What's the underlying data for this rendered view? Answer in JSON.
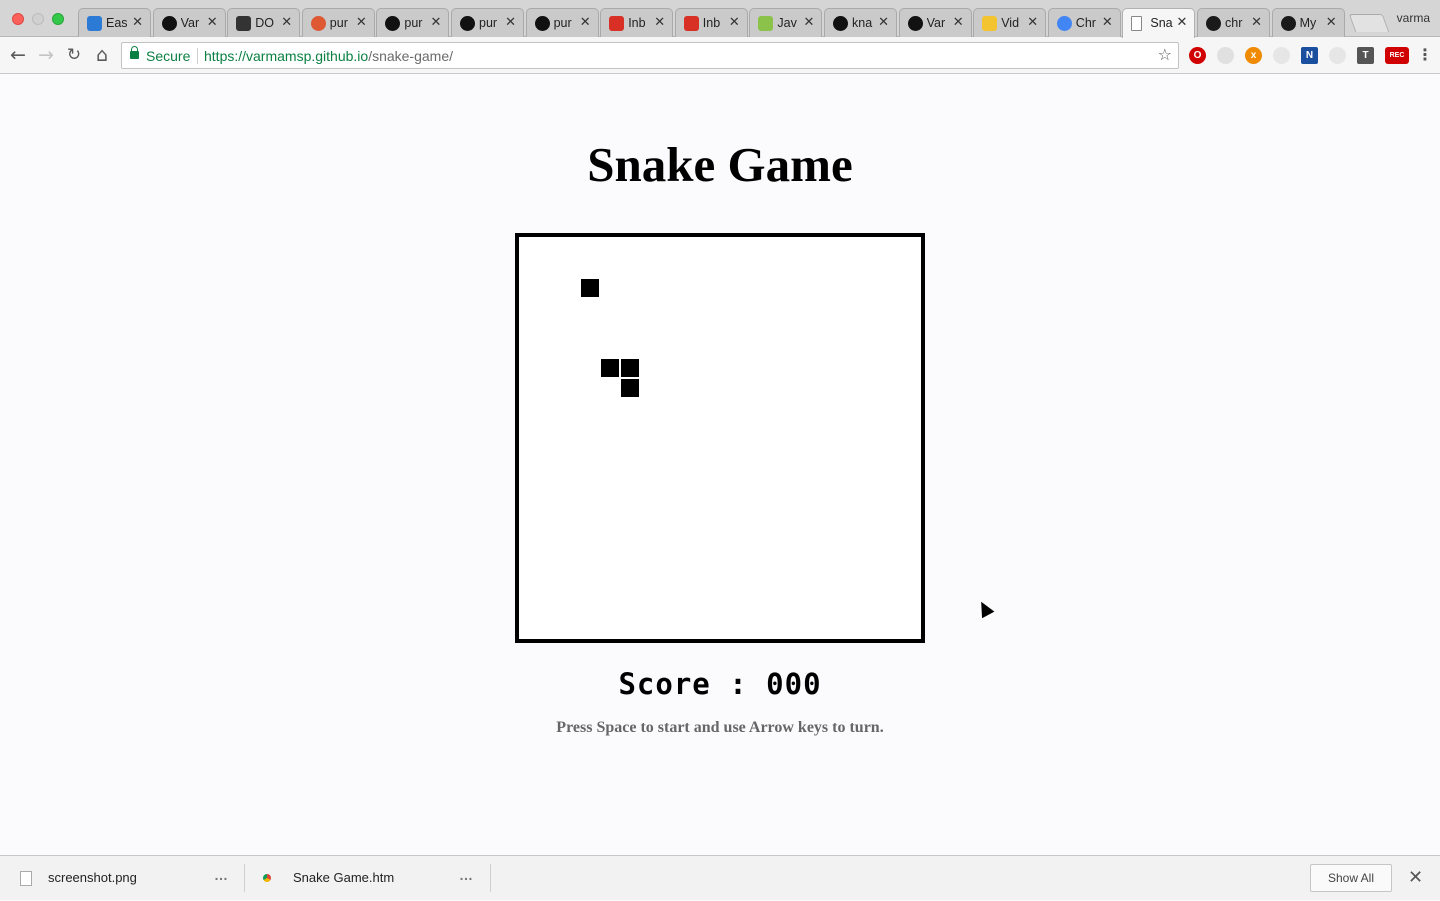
{
  "browser": {
    "profile_name": "varma",
    "tabs": [
      {
        "title": "Eas",
        "icon": "easy-icon",
        "icon_color": "#2b7bd6",
        "active": false
      },
      {
        "title": "Var",
        "icon": "github-icon",
        "icon_color": "#111111",
        "active": false
      },
      {
        "title": "DO",
        "icon": "dom-link-icon",
        "icon_color": "#333333",
        "active": false
      },
      {
        "title": "pur",
        "icon": "duckduckgo-icon",
        "icon_color": "#de5833",
        "active": false
      },
      {
        "title": "pur",
        "icon": "github-icon",
        "icon_color": "#111111",
        "active": false
      },
      {
        "title": "pur",
        "icon": "github-icon",
        "icon_color": "#111111",
        "active": false
      },
      {
        "title": "pur",
        "icon": "github-icon",
        "icon_color": "#111111",
        "active": false
      },
      {
        "title": "Inb",
        "icon": "gmail-icon",
        "icon_color": "#d93025",
        "active": false
      },
      {
        "title": "Inb",
        "icon": "gmail-icon",
        "icon_color": "#d93025",
        "active": false
      },
      {
        "title": "Jav",
        "icon": "javascript-icon",
        "icon_color": "#8bc34a",
        "active": false
      },
      {
        "title": "kna",
        "icon": "github-icon",
        "icon_color": "#111111",
        "active": false
      },
      {
        "title": "Var",
        "icon": "github-icon",
        "icon_color": "#111111",
        "active": false
      },
      {
        "title": "Vid",
        "icon": "video-icon",
        "icon_color": "#f4c430",
        "active": false
      },
      {
        "title": "Chr",
        "icon": "chrome-icon",
        "icon_color": "#4285f4",
        "active": false
      },
      {
        "title": "Sna",
        "icon": "page-icon",
        "icon_color": "#ffffff",
        "active": true
      },
      {
        "title": "chr",
        "icon": "chrome-dev-icon",
        "icon_color": "#1a1a1a",
        "active": false
      },
      {
        "title": "My",
        "icon": "chrome-dev-icon",
        "icon_color": "#1a1a1a",
        "active": false
      }
    ],
    "secure_label": "Secure",
    "url_scheme_host": "https://varmamsp.github.io",
    "url_path": "/snake-game/",
    "extensions": [
      {
        "name": "opera-icon",
        "color": "#d00000",
        "glyph": "O"
      },
      {
        "name": "extension-blank-icon",
        "color": "#e0e0e0",
        "glyph": ""
      },
      {
        "name": "orange-x-icon",
        "color": "#f08a00",
        "glyph": "x"
      },
      {
        "name": "circle-icon",
        "color": "#e6e6e6",
        "glyph": ""
      },
      {
        "name": "n-icon",
        "color": "#1a4fa0",
        "glyph": "N"
      },
      {
        "name": "gear-ext-icon",
        "color": "#e6e6e6",
        "glyph": ""
      },
      {
        "name": "t-icon",
        "color": "#555555",
        "glyph": "T"
      },
      {
        "name": "rec-icon",
        "color": "#1a7f3a",
        "glyph": "REC"
      }
    ]
  },
  "page": {
    "title": "Snake Game",
    "score_label": "Score : 000",
    "instructions": "Press Space to start and use Arrow keys to turn.",
    "food": {
      "col": 3,
      "row": 2
    },
    "snake": [
      {
        "col": 5,
        "row": 7
      },
      {
        "col": 5,
        "row": 6
      },
      {
        "col": 4,
        "row": 6
      }
    ]
  },
  "downloads": {
    "items": [
      {
        "name": "screenshot.png",
        "icon": "file-icon"
      },
      {
        "name": "Snake Game.htm",
        "icon": "chrome-file-icon"
      }
    ],
    "more_label": "…",
    "show_all_label": "Show All",
    "close_label": "✕"
  }
}
